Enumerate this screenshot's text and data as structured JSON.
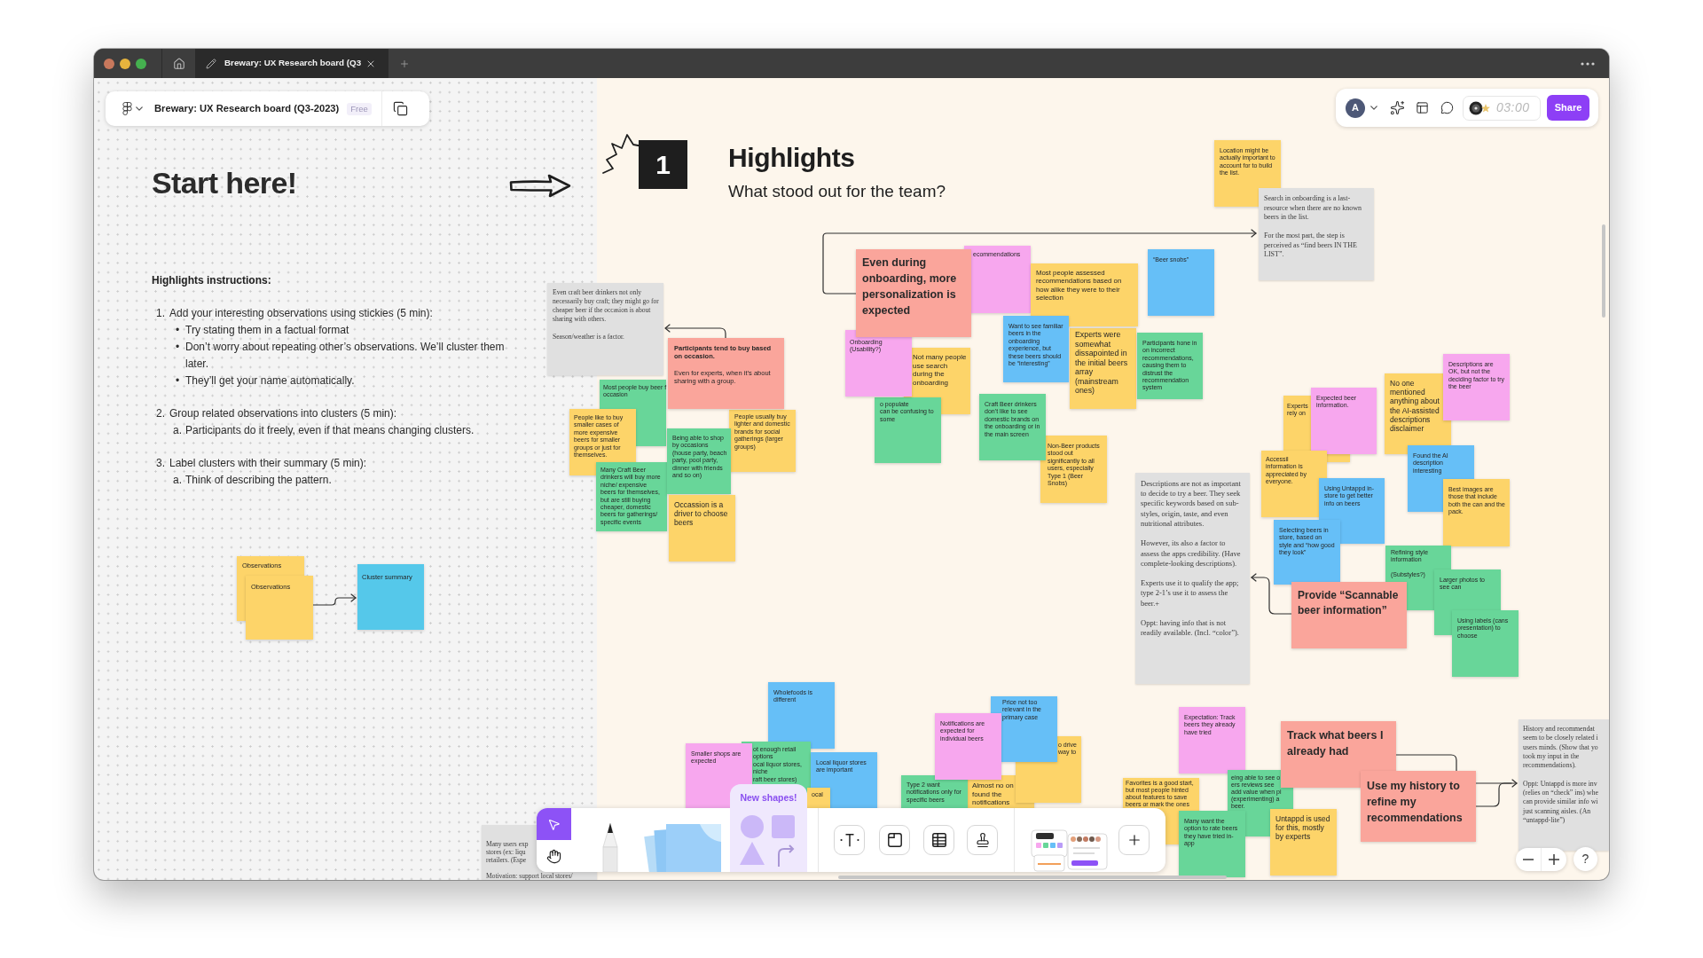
{
  "window": {
    "tab_title": "Brewary: UX Research board (Q3"
  },
  "file_bar": {
    "title": "Brewary: UX Research board (Q3-2023)",
    "badge": "Free"
  },
  "top_toolbar": {
    "avatar": "A",
    "timer": "03:00",
    "share": "Share"
  },
  "intro": {
    "title": "Start here!",
    "heading": "Highlights instructions:",
    "steps": [
      {
        "marker": "1.",
        "text": "Add your interesting observations using stickies (5 min):",
        "children": [
          {
            "marker": "•",
            "text": "Try stating them in a factual format"
          },
          {
            "marker": "•",
            "text": "Don’t worry about repeating other’s observations. We’ll cluster them later."
          },
          {
            "marker": "•",
            "text": "They’ll get your name automatically."
          }
        ]
      },
      {
        "marker": "2.",
        "text": "Group related observations into clusters (5 min):",
        "children": [
          {
            "marker": "a.",
            "text": "Participants do it freely, even if that means changing clusters."
          }
        ]
      },
      {
        "marker": "3.",
        "text": "Label clusters with their summary (5 min):",
        "children": [
          {
            "marker": "a.",
            "text": "Think of describing the pattern."
          }
        ]
      }
    ]
  },
  "legend": [
    {
      "text": "Observations",
      "color": "#fdd469"
    },
    {
      "text": "Observations",
      "color": "#fdd469"
    },
    {
      "text": "Cluster summary",
      "color": "#55c8ea"
    }
  ],
  "section": {
    "number": "1",
    "title": "Highlights",
    "subtitle": "What stood out for the team?"
  },
  "board": {
    "items": [
      {
        "kind": "note",
        "color": "#e0e0e0",
        "text": "Even craft beer drinkers not only necessarily buy craft; they might go for cheaper beer if the occasion is about sharing with others.\n\nSeason/weather is a factor."
      },
      {
        "kind": "sticky",
        "color": "#faa59b",
        "title": "Participants tend to buy based on occasion.",
        "text": "Even for experts, when it’s about sharing with a group."
      },
      {
        "kind": "sticky",
        "color": "#68d699",
        "text": "Most people buy beer f\noccasion"
      },
      {
        "kind": "sticky",
        "color": "#fdd469",
        "text": "People like to buy smaller cases of more expensive beers for smaller groups or just for themselves."
      },
      {
        "kind": "sticky",
        "color": "#fdd469",
        "text": "People usually buy lighter and domestic brands for social gatherings (larger groups)"
      },
      {
        "kind": "sticky",
        "color": "#68d699",
        "text": "Many Craft Beer drinkers will buy more niche/ expensive beers for themselves, but are still buying cheaper, domestic beers for gatherings/ specific events"
      },
      {
        "kind": "sticky",
        "color": "#68d699",
        "text": "Being able to shop by occasions (house party, beach party, pool party, dinner with friends and so on)"
      },
      {
        "kind": "sticky",
        "color": "#fdd469",
        "text": "Occassion is a driver to choose beers"
      },
      {
        "kind": "summary",
        "color": "#faa59b",
        "text": "Even during onboarding, more personalization is expected"
      },
      {
        "kind": "sticky",
        "color": "#f7a7ee",
        "text": "Onboarding (Usability?)"
      },
      {
        "kind": "sticky",
        "color": "#fdd469",
        "text": "Not many people use search during the onboarding"
      },
      {
        "kind": "sticky",
        "color": "#68d699",
        "text": "o populate\ncan be confusing to some"
      },
      {
        "kind": "sticky",
        "color": "#f7a7ee",
        "text": "ecommendations"
      },
      {
        "kind": "sticky",
        "color": "#fdd469",
        "text": "Most people assessed recommendations based on how alike they were to their selection"
      },
      {
        "kind": "sticky",
        "color": "#66bff7",
        "text": "“Beer snobs”"
      },
      {
        "kind": "sticky",
        "color": "#66bff7",
        "text": "Want to see familiar beers in the onboarding experience, but these beers should be “interesting”"
      },
      {
        "kind": "sticky",
        "color": "#fdd469",
        "text": "Experts were somewhat dissapointed in the initial beers array (mainstream ones)"
      },
      {
        "kind": "sticky",
        "color": "#68d699",
        "text": "Participants hone in on incorrect recommendations, causing them to distrust the recommendation system"
      },
      {
        "kind": "sticky",
        "color": "#68d699",
        "text": "Craft Beer drinkers don’t like to see domestic brands on the onboarding or in the main screen"
      },
      {
        "kind": "sticky",
        "color": "#fdd469",
        "text": "Non-Beer products stood out significantly to all users, especially Type 1 (Beer Snobs)"
      },
      {
        "kind": "sticky",
        "color": "#fdd469",
        "text": "Location might be actually important to account for to build the list."
      },
      {
        "kind": "note",
        "color": "#e0e0e0",
        "text": "Search in onboarding is a last-resource when there are no known beers in the list.\n\nFor the most part, the step is perceived as “find beers IN THE LIST”."
      },
      {
        "kind": "note",
        "color": "#e0e0e0",
        "text": "Descriptions are not as important to decide to try a beer. They seek specific keywords based on sub-styles, origin, taste, and even nutritional attributes.\n\nHowever, its also a factor to assess the apps credibility. (Have complete-looking descriptions).\n\nExperts use it to qualify the app; type 2-1’s use it to assess the beer.+\n\nOppt: having info that is not readily available. (Incl. “color”)."
      },
      {
        "kind": "sticky",
        "color": "#fdd469",
        "text": "Experts\nrely on"
      },
      {
        "kind": "sticky",
        "color": "#f7a7ee",
        "text": "Expected beer information."
      },
      {
        "kind": "sticky",
        "color": "#fdd469",
        "text": "Accessil\ninformation is appreciated by everyone."
      },
      {
        "kind": "sticky",
        "color": "#66bff7",
        "text": "Using Untappd in-store to get better info on beers"
      },
      {
        "kind": "sticky",
        "color": "#66bff7",
        "text": "Selecting beers in store, based on style and “how good they look”"
      },
      {
        "kind": "sticky",
        "color": "#fdd469",
        "text": "No one mentioned anything about the AI-assisted descriptions disclaimer"
      },
      {
        "kind": "sticky",
        "color": "#f7a7ee",
        "text": "Descriptions are OK, but not the deciding factor to try the beer"
      },
      {
        "kind": "sticky",
        "color": "#66bff7",
        "text": "Found the AI description interesting"
      },
      {
        "kind": "sticky",
        "color": "#fdd469",
        "text": "Best images are those that include both the can and the pack."
      },
      {
        "kind": "sticky",
        "color": "#68d699",
        "text": "Refining style information\n\n(Substyles?)"
      },
      {
        "kind": "sticky",
        "color": "#68d699",
        "text": "Larger photos to see can"
      },
      {
        "kind": "sticky",
        "color": "#68d699",
        "text": "Using labels (cans presentation) to choose"
      },
      {
        "kind": "summary",
        "color": "#faa59b",
        "text": "Provide “Scannable beer information”"
      },
      {
        "kind": "sticky",
        "color": "#66bff7",
        "text": "Wholefoods is different"
      },
      {
        "kind": "sticky",
        "color": "#f7a7ee",
        "text": "Smaller shops are expected"
      },
      {
        "kind": "sticky",
        "color": "#68d699",
        "text": "ot enough retail options\nocal liquor stores, niche\nraft beer stores)"
      },
      {
        "kind": "sticky",
        "color": "#66bff7",
        "text": "Local liquor stores are important"
      },
      {
        "kind": "sticky",
        "color": "#fdd469",
        "text": "ocal"
      },
      {
        "kind": "sticky",
        "color": "#f7a7ee",
        "text": "Notifications are expected for individual beers"
      },
      {
        "kind": "sticky",
        "color": "#66bff7",
        "text": "Price not too relevant in the primary case"
      },
      {
        "kind": "sticky",
        "color": "#fdd469",
        "text": "o drive\nway to"
      },
      {
        "kind": "sticky",
        "color": "#68d699",
        "text": "Type 2 want notifications only for specific beers"
      },
      {
        "kind": "sticky",
        "color": "#fdd469",
        "text": "Almost no on\nfound the\nnotifications"
      },
      {
        "kind": "sticky",
        "color": "#f7a7ee",
        "text": "Expectation: Track beers they already have tried"
      },
      {
        "kind": "sticky",
        "color": "#fdd469",
        "text": "Favorites is a good start,\nbut most people hinted\nabout features to save\nbeers or mark the ones"
      },
      {
        "kind": "sticky",
        "color": "#68d699",
        "text": "eing able to see o\ners reviews see\nadd value when pi\n(experimenting) a\nbeer."
      },
      {
        "kind": "sticky",
        "color": "#68d699",
        "text": "Many want the option to rate beers they have tried in-app"
      },
      {
        "kind": "summary",
        "color": "#faa59b",
        "text": "Track what beers I already had"
      },
      {
        "kind": "summary",
        "color": "#faa59b",
        "text": "Use my history to refine my recommendations"
      },
      {
        "kind": "sticky",
        "color": "#fdd469",
        "text": "Untappd is used for this, mostly by experts"
      },
      {
        "kind": "note",
        "color": "#e0e0e0",
        "text": "History and recommendat\nseem to be closely related i\nusers minds. (Show that yo\ntook my input in the\nrecommendations).\n\nOppt: Untappd is more inv\n(relies on “check” ins) whe\ncan provide similar info wi\njust scanning aisles. (An\n“untappd-lite”)"
      },
      {
        "kind": "note",
        "color": "#e0e0e0",
        "text": "Many users exp\nstores (ex: liqu\nretailers. (Espe\n\nMotivation: support local stores/"
      }
    ]
  },
  "toolbar": {
    "tools": [
      {
        "kind": "select",
        "selected": true
      },
      {
        "kind": "hand",
        "selected": false
      },
      {
        "kind": "marker",
        "selected": false
      },
      {
        "kind": "sticky",
        "selected": false
      },
      {
        "kind": "shapes",
        "label": "New shapes!",
        "selected": false
      },
      {
        "kind": "text",
        "selected": false
      },
      {
        "kind": "section",
        "selected": false
      },
      {
        "kind": "table",
        "selected": false
      },
      {
        "kind": "stamp",
        "selected": false
      },
      {
        "kind": "widgets",
        "selected": false
      },
      {
        "kind": "add",
        "selected": false
      }
    ]
  },
  "zoom_controls": {
    "help": "?"
  }
}
